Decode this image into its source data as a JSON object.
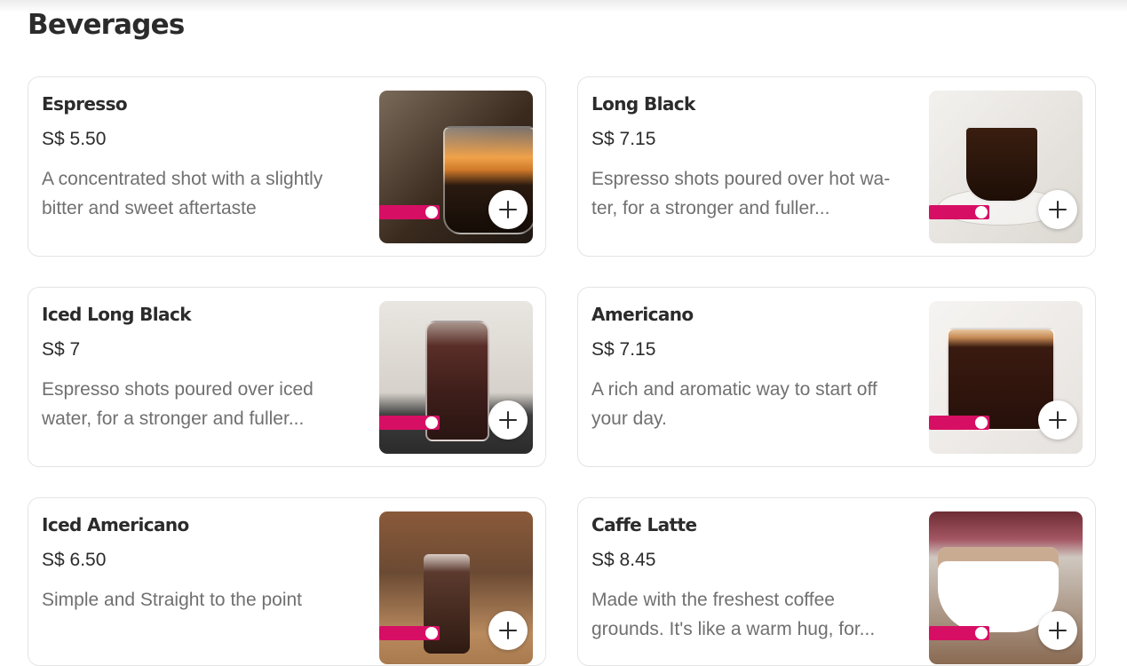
{
  "section": {
    "title": "Beverages"
  },
  "items": [
    {
      "name": "Espresso",
      "price": "S$ 5.50",
      "description": "A concentrated shot with a slightly bitter and sweet aftertaste"
    },
    {
      "name": "Long Black",
      "price": "S$ 7.15",
      "description": "Espresso shots poured over hot wa­ter, for a stronger and fuller..."
    },
    {
      "name": "Iced Long Black",
      "price": "S$ 7",
      "description": "Espresso shots poured over iced water, for a stronger and fuller..."
    },
    {
      "name": "Americano",
      "price": "S$ 7.15",
      "description": "A rich and aromatic way to start off your day."
    },
    {
      "name": "Iced Americano",
      "price": "S$ 6.50",
      "description": "Simple and Straight to the point"
    },
    {
      "name": "Caffe Latte",
      "price": "S$ 8.45",
      "description": "Made with the freshest coffee grounds. It's like a warm hug, for..."
    }
  ],
  "icons": {
    "add": "plus-icon",
    "brand_badge": "foodpanda-badge"
  },
  "colors": {
    "brand": "#d70f64",
    "text": "#2b2b2b",
    "muted": "#707070",
    "border": "#e4e4e4"
  }
}
